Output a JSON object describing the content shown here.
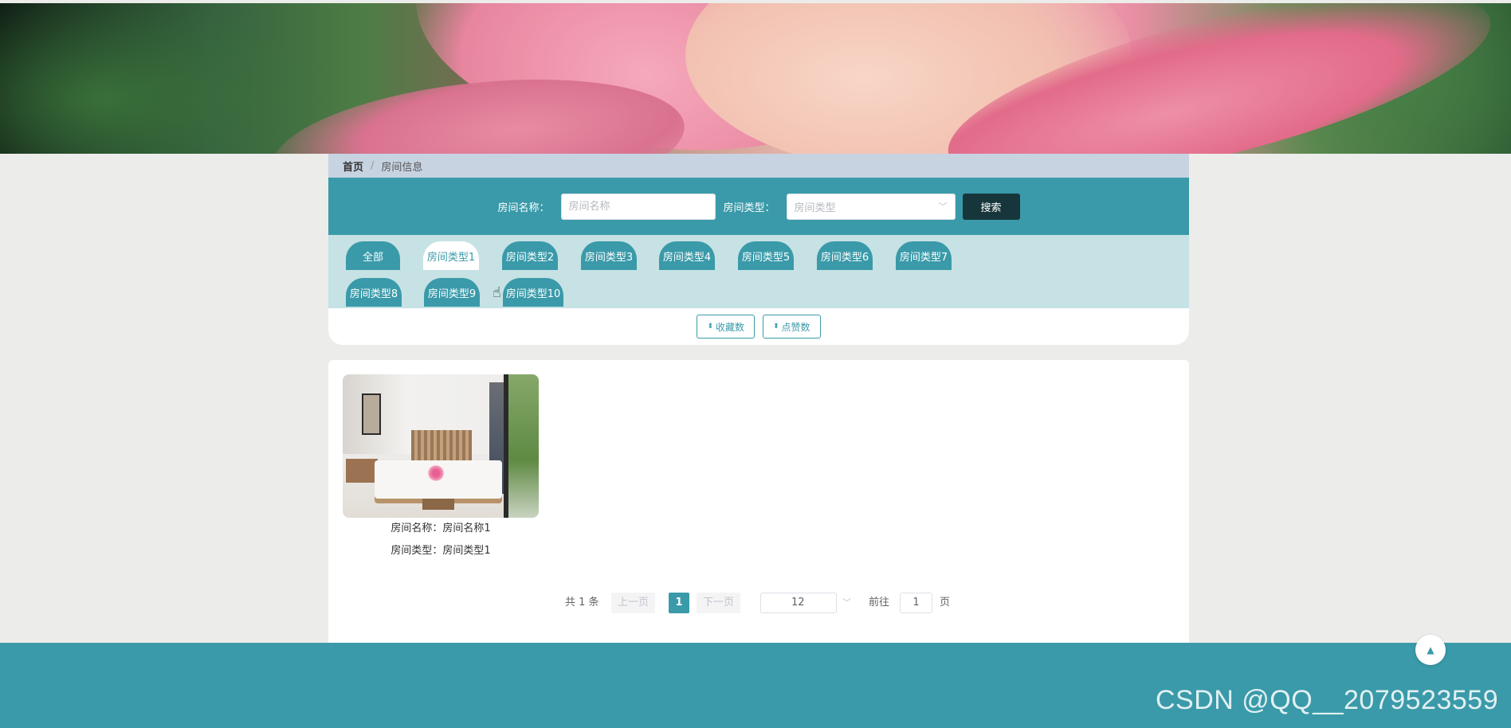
{
  "breadcrumb": {
    "home": "首页",
    "separator": "/",
    "current": "房间信息"
  },
  "search": {
    "name_label": "房间名称：",
    "name_placeholder": "房间名称",
    "type_label": "房间类型：",
    "type_placeholder": "房间类型",
    "button_label": "搜索"
  },
  "type_tabs": {
    "all": "全部",
    "t1": "房间类型1",
    "t2": "房间类型2",
    "t3": "房间类型3",
    "t4": "房间类型4",
    "t5": "房间类型5",
    "t6": "房间类型6",
    "t7": "房间类型7",
    "t8": "房间类型8",
    "t9": "房间类型9",
    "t10": "房间类型10",
    "active": "房间类型1"
  },
  "sort": {
    "favorites": "收藏数",
    "likes": "点赞数"
  },
  "rooms": [
    {
      "name_line": "房间名称：房间名称1",
      "type_line": "房间类型：房间类型1"
    }
  ],
  "pagination": {
    "total": "共 1 条",
    "prev": "上一页",
    "current": "1",
    "next": "下一页",
    "page_size": "12",
    "goto_label": "前往",
    "goto_value": "1",
    "page_suffix": "页"
  },
  "watermark": "CSDN @QQ__2079523559",
  "colors": {
    "primary": "#3a9aa9",
    "dark_button": "#17363c",
    "breadcrumb_bg": "#c7d3e1",
    "tab_area_bg": "#c6e2e4"
  }
}
